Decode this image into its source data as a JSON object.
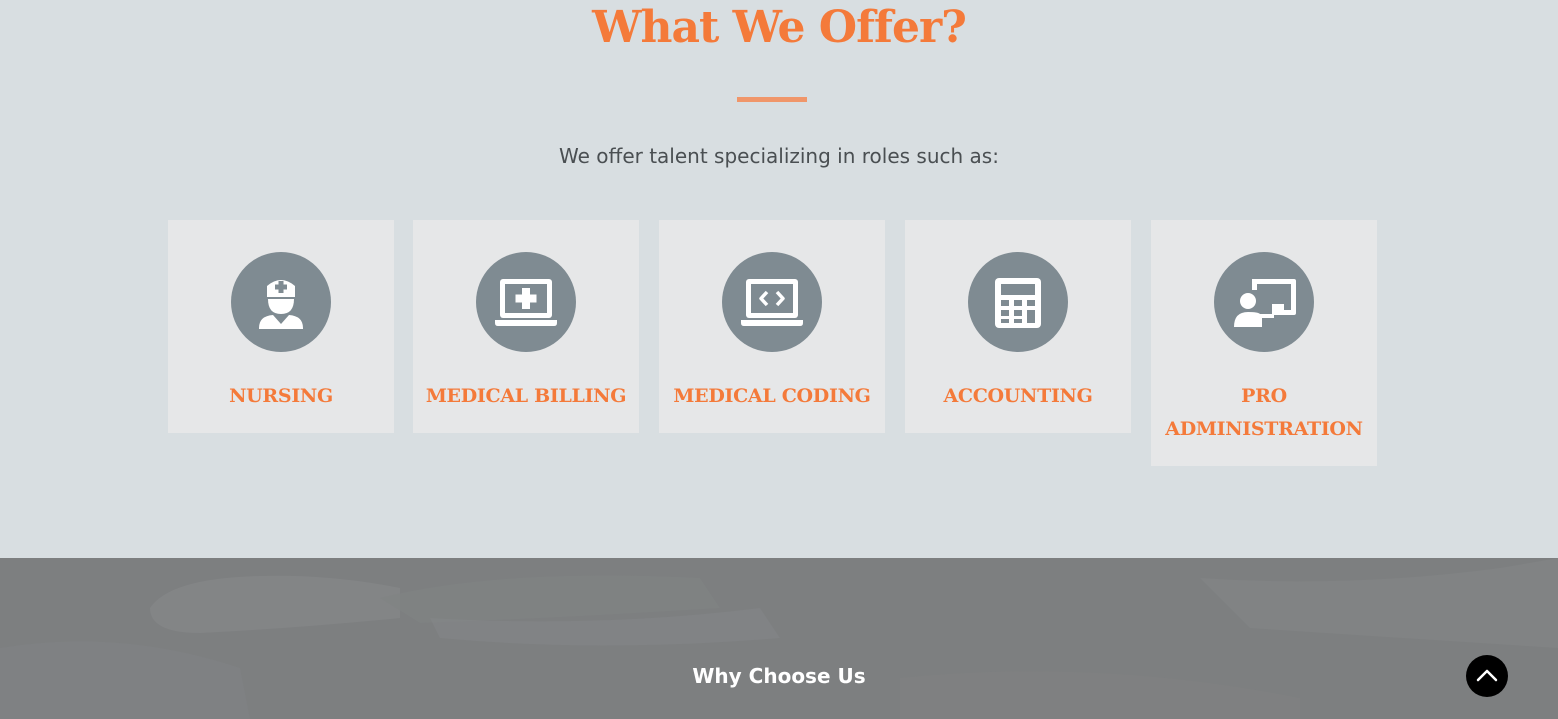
{
  "offer": {
    "title": "What We Offer?",
    "subtitle": "We offer talent specializing in roles such as:",
    "cards": [
      {
        "label": "NURSING",
        "icon": "nurse-icon"
      },
      {
        "label": "MEDICAL BILLING",
        "icon": "laptop-medical-icon"
      },
      {
        "label": "MEDICAL CODING",
        "icon": "laptop-code-icon"
      },
      {
        "label": "ACCOUNTING",
        "icon": "calculator-icon"
      },
      {
        "label": "PRO ADMINISTRATION",
        "icon": "chalkboard-teacher-icon"
      }
    ]
  },
  "why": {
    "title": "Why Choose Us"
  },
  "scroll_top": {
    "icon": "chevron-up-icon"
  },
  "colors": {
    "accent": "#f47a3a",
    "section_bg": "#d8dee1",
    "card_bg": "#e6e7e8",
    "icon_circle": "#7f8b92",
    "why_bg": "#7d7f80"
  }
}
